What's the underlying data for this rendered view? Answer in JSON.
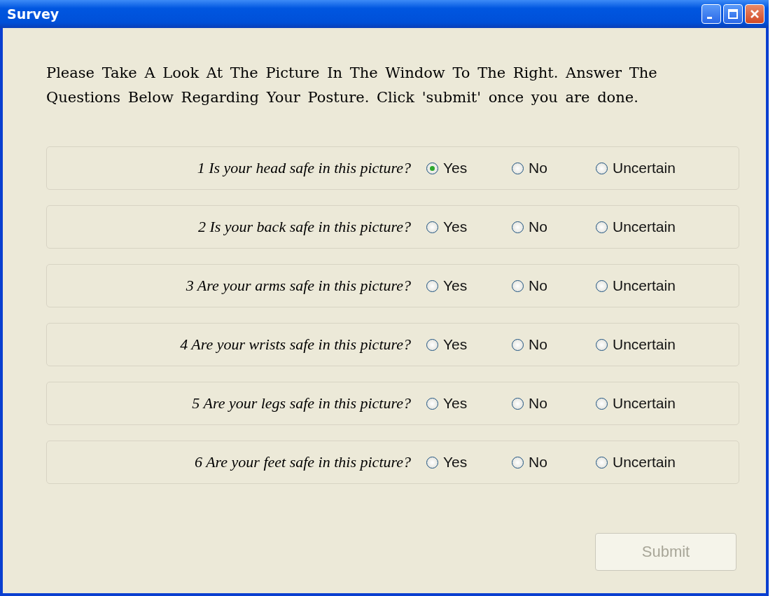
{
  "window": {
    "title": "Survey"
  },
  "intro": "Please Take A Look At The Picture In The Window To The Right. Answer The Questions Below Regarding Your Posture. Click 'submit' once you are done.",
  "questions": [
    {
      "number": "1",
      "text": "Is your head safe in this picture?",
      "options": [
        {
          "label": "Yes",
          "selected": true
        },
        {
          "label": "No",
          "selected": false
        },
        {
          "label": "Uncertain",
          "selected": false
        }
      ]
    },
    {
      "number": "2",
      "text": "Is your back safe in this picture?",
      "options": [
        {
          "label": "Yes",
          "selected": false
        },
        {
          "label": "No",
          "selected": false
        },
        {
          "label": "Uncertain",
          "selected": false
        }
      ]
    },
    {
      "number": "3",
      "text": "Are your arms safe in this picture?",
      "options": [
        {
          "label": "Yes",
          "selected": false
        },
        {
          "label": "No",
          "selected": false
        },
        {
          "label": "Uncertain",
          "selected": false
        }
      ]
    },
    {
      "number": "4",
      "text": "Are your wrists safe in this picture?",
      "options": [
        {
          "label": "Yes",
          "selected": false
        },
        {
          "label": "No",
          "selected": false
        },
        {
          "label": "Uncertain",
          "selected": false
        }
      ]
    },
    {
      "number": "5",
      "text": "Are your legs safe in this picture?",
      "options": [
        {
          "label": "Yes",
          "selected": false
        },
        {
          "label": "No",
          "selected": false
        },
        {
          "label": "Uncertain",
          "selected": false
        }
      ]
    },
    {
      "number": "6",
      "text": "Are your feet safe in this picture?",
      "options": [
        {
          "label": "Yes",
          "selected": false
        },
        {
          "label": "No",
          "selected": false
        },
        {
          "label": "Uncertain",
          "selected": false
        }
      ]
    }
  ],
  "submit": {
    "label": "Submit",
    "disabled": true
  }
}
